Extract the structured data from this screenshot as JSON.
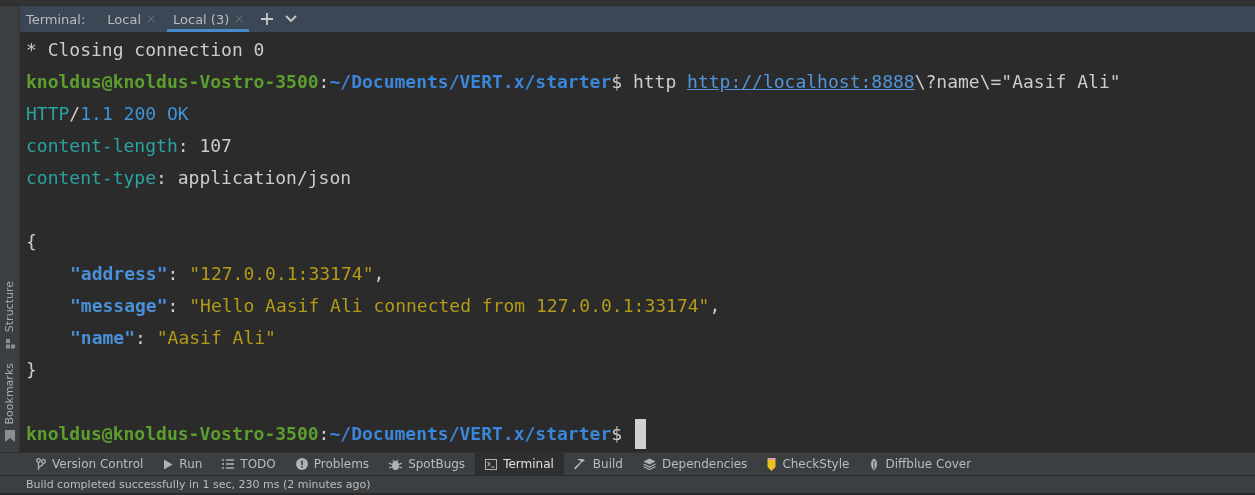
{
  "terminal_tabs": {
    "label": "Terminal:",
    "tabs": [
      {
        "label": "Local",
        "selected": false
      },
      {
        "label": "Local (3)",
        "selected": true
      }
    ]
  },
  "terminal": {
    "lines": [
      {
        "kind": "text",
        "segments": [
          {
            "kind": "plain",
            "text": "* Closing connection 0"
          }
        ]
      },
      {
        "kind": "text",
        "segments": [
          {
            "kind": "user",
            "text": "knoldus@knoldus-Vostro-3500"
          },
          {
            "kind": "plain",
            "text": ":"
          },
          {
            "kind": "path",
            "text": "~/Documents/VERT.x/starter"
          },
          {
            "kind": "plain",
            "text": "$ http "
          },
          {
            "kind": "url",
            "text": "http://localhost:8888"
          },
          {
            "kind": "plain",
            "text": "\\?name\\=\"Aasif Ali\""
          }
        ]
      },
      {
        "kind": "text",
        "segments": [
          {
            "kind": "header",
            "text": "HTTP"
          },
          {
            "kind": "plain",
            "text": "/"
          },
          {
            "kind": "status",
            "text": "1.1 200 OK"
          }
        ]
      },
      {
        "kind": "text",
        "segments": [
          {
            "kind": "header",
            "text": "content-length"
          },
          {
            "kind": "plain",
            "text": ": 107"
          }
        ]
      },
      {
        "kind": "text",
        "segments": [
          {
            "kind": "header",
            "text": "content-type"
          },
          {
            "kind": "plain",
            "text": ": application/json"
          }
        ]
      },
      {
        "kind": "blank"
      },
      {
        "kind": "text",
        "segments": [
          {
            "kind": "plain",
            "text": "{"
          }
        ]
      },
      {
        "kind": "text",
        "indented": true,
        "segments": [
          {
            "kind": "key",
            "text": "\"address\""
          },
          {
            "kind": "plain",
            "text": ": "
          },
          {
            "kind": "string",
            "text": "\"127.0.0.1:33174\""
          },
          {
            "kind": "plain",
            "text": ","
          }
        ]
      },
      {
        "kind": "text",
        "indented": true,
        "segments": [
          {
            "kind": "key",
            "text": "\"message\""
          },
          {
            "kind": "plain",
            "text": ": "
          },
          {
            "kind": "string",
            "text": "\"Hello Aasif Ali connected from 127.0.0.1:33174\""
          },
          {
            "kind": "plain",
            "text": ","
          }
        ]
      },
      {
        "kind": "text",
        "indented": true,
        "segments": [
          {
            "kind": "key",
            "text": "\"name\""
          },
          {
            "kind": "plain",
            "text": ": "
          },
          {
            "kind": "string",
            "text": "\"Aasif Ali\""
          }
        ]
      },
      {
        "kind": "text",
        "segments": [
          {
            "kind": "plain",
            "text": "}"
          }
        ]
      },
      {
        "kind": "blank"
      },
      {
        "kind": "prompt",
        "segments": [
          {
            "kind": "user",
            "text": "knoldus@knoldus-Vostro-3500"
          },
          {
            "kind": "plain",
            "text": ":"
          },
          {
            "kind": "path",
            "text": "~/Documents/VERT.x/starter"
          },
          {
            "kind": "plain",
            "text": "$ "
          }
        ]
      }
    ]
  },
  "side_panel": {
    "items": [
      {
        "kind": "structure",
        "label": "Structure"
      },
      {
        "kind": "bookmarks",
        "label": "Bookmarks"
      }
    ]
  },
  "tool_windows": [
    {
      "kind": "vcs",
      "label": "Version Control",
      "selected": false
    },
    {
      "kind": "run",
      "label": "Run",
      "selected": false
    },
    {
      "kind": "todo",
      "label": "TODO",
      "selected": false
    },
    {
      "kind": "problems",
      "label": "Problems",
      "selected": false
    },
    {
      "kind": "bug",
      "label": "SpotBugs",
      "selected": false
    },
    {
      "kind": "terminal",
      "label": "Terminal",
      "selected": true
    },
    {
      "kind": "build",
      "label": "Build",
      "selected": false
    },
    {
      "kind": "deps",
      "label": "Dependencies",
      "selected": false
    },
    {
      "kind": "checkstyle",
      "label": "CheckStyle",
      "selected": false
    },
    {
      "kind": "diffblue",
      "label": "Diffblue Cover",
      "selected": false
    }
  ],
  "status_bar": {
    "text": "Build completed successfully in 1 sec, 230 ms (2 minutes ago)"
  }
}
